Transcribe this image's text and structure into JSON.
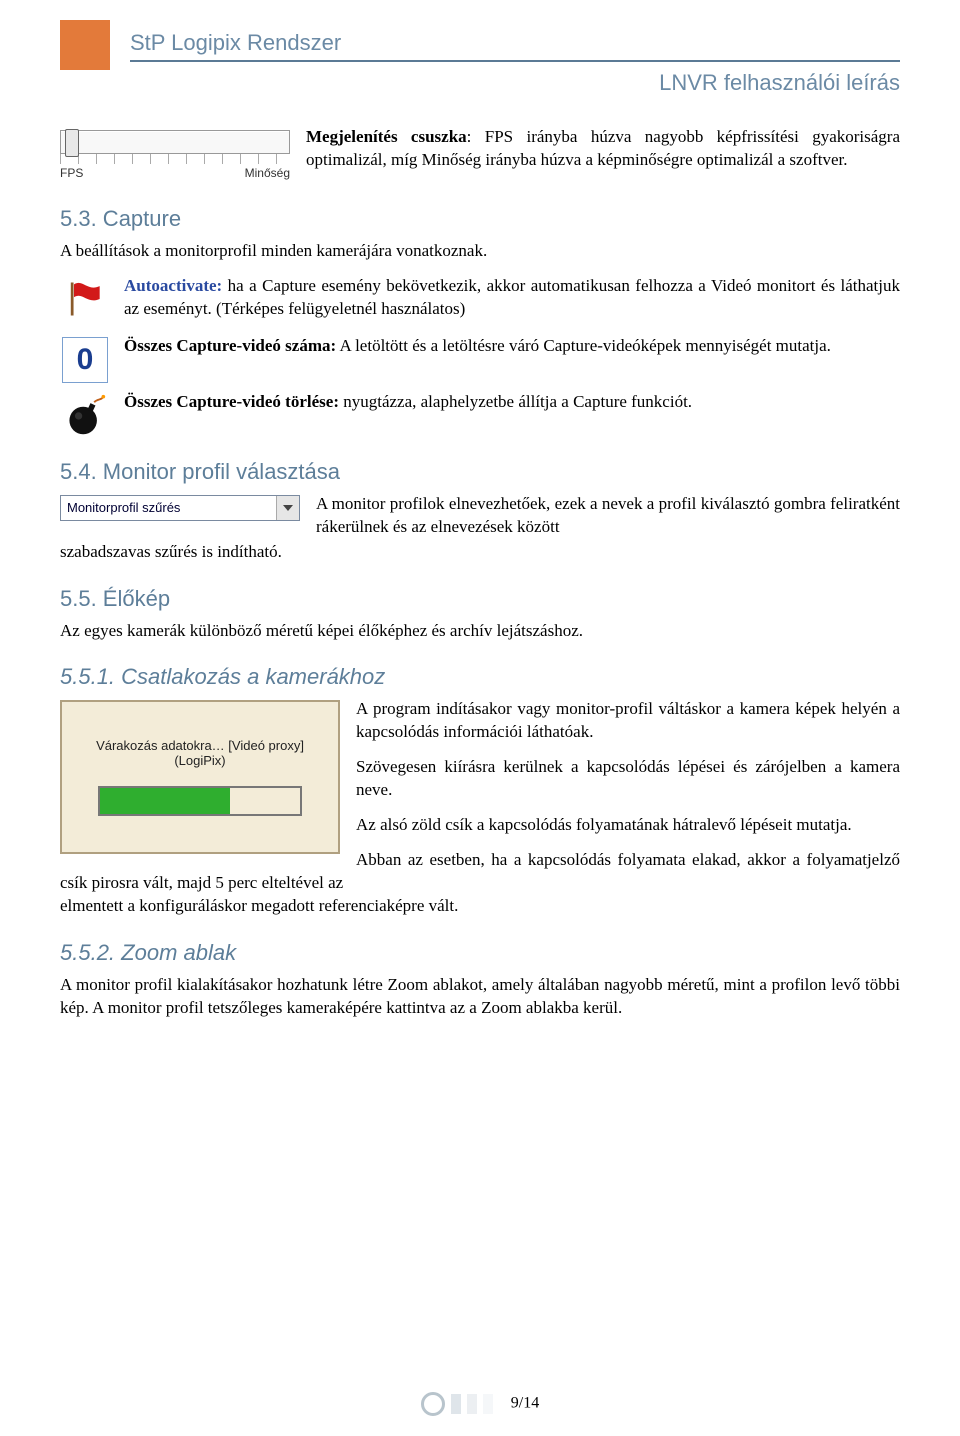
{
  "header": {
    "title": "StP Logipix Rendszer",
    "subtitle": "LNVR felhasználói leírás"
  },
  "slider": {
    "left_label": "FPS",
    "right_label": "Minőség"
  },
  "intro_para": {
    "bold": "Megjelenítés csuszka",
    "text": ": FPS irányba húzva nagyobb képfrissítési gyakoriságra optimalizál, míg Minőség irányba húzva a képminőségre optimalizál a szoftver."
  },
  "sec53": {
    "heading": "5.3. Capture",
    "para": "A beállítások a monitorprofil minden kamerájára vonatkoznak."
  },
  "items": {
    "auto": {
      "bold": "Autoactivate:",
      "text": " ha a Capture esemény bekövetkezik, akkor automatikusan felhozza a Videó monitort és láthatjuk az eseményt. (Térképes felügyeletnél használatos)"
    },
    "count": {
      "bold": "Összes Capture-videó száma:",
      "text": " A letöltött és a letöltésre váró Capture-videóképek mennyiségét mutatja."
    },
    "delete": {
      "bold": "Összes Capture-videó törlése:",
      "text": " nyugtázza, alaphelyzetbe állítja a Capture funkciót."
    }
  },
  "sec54": {
    "heading": "5.4. Monitor profil választása",
    "dd_text": "Monitorprofil szűrés",
    "para1": "A monitor profilok elnevezhetőek, ezek a nevek a profil kiválasztó gombra feliratként rákerülnek és az elnevezések között",
    "para2": "szabadszavas szűrés is indítható."
  },
  "sec55": {
    "heading": "5.5. Élőkép",
    "para": "Az egyes kamerák különböző méretű képei élőképhez és archív lejátszáshoz."
  },
  "sec551": {
    "heading": "5.5.1. Csatlakozás a kamerákhoz",
    "cam_line1": "Várakozás adatokra… [Videó proxy]",
    "cam_line2": "(LogiPix)",
    "p1": "A program indításakor vagy monitor-profil váltáskor a kamera képek helyén a kapcsolódás információi láthatóak.",
    "p2": "Szövegesen kiírásra kerülnek a kapcsolódás lépései és zárójelben a kamera neve.",
    "p3": "Az alsó zöld csík a kapcsolódás folyamatának hátralevő lépéseit mutatja.",
    "p4": "Abban az esetben, ha a kapcsolódás folyamata elakad, akkor a folyamatjelző csík pirosra vált, majd 5 perc elteltével az",
    "p5": "elmentett  a konfiguráláskor megadott referenciaképre vált."
  },
  "sec552": {
    "heading": "5.5.2. Zoom ablak",
    "para": "A monitor profil kialakításakor hozhatunk létre Zoom ablakot, amely általában nagyobb méretű, mint a profilon levő többi kép. A monitor profil tetszőleges kameraképére kattintva az a Zoom ablakba kerül."
  },
  "footer": {
    "page": "9/14"
  }
}
